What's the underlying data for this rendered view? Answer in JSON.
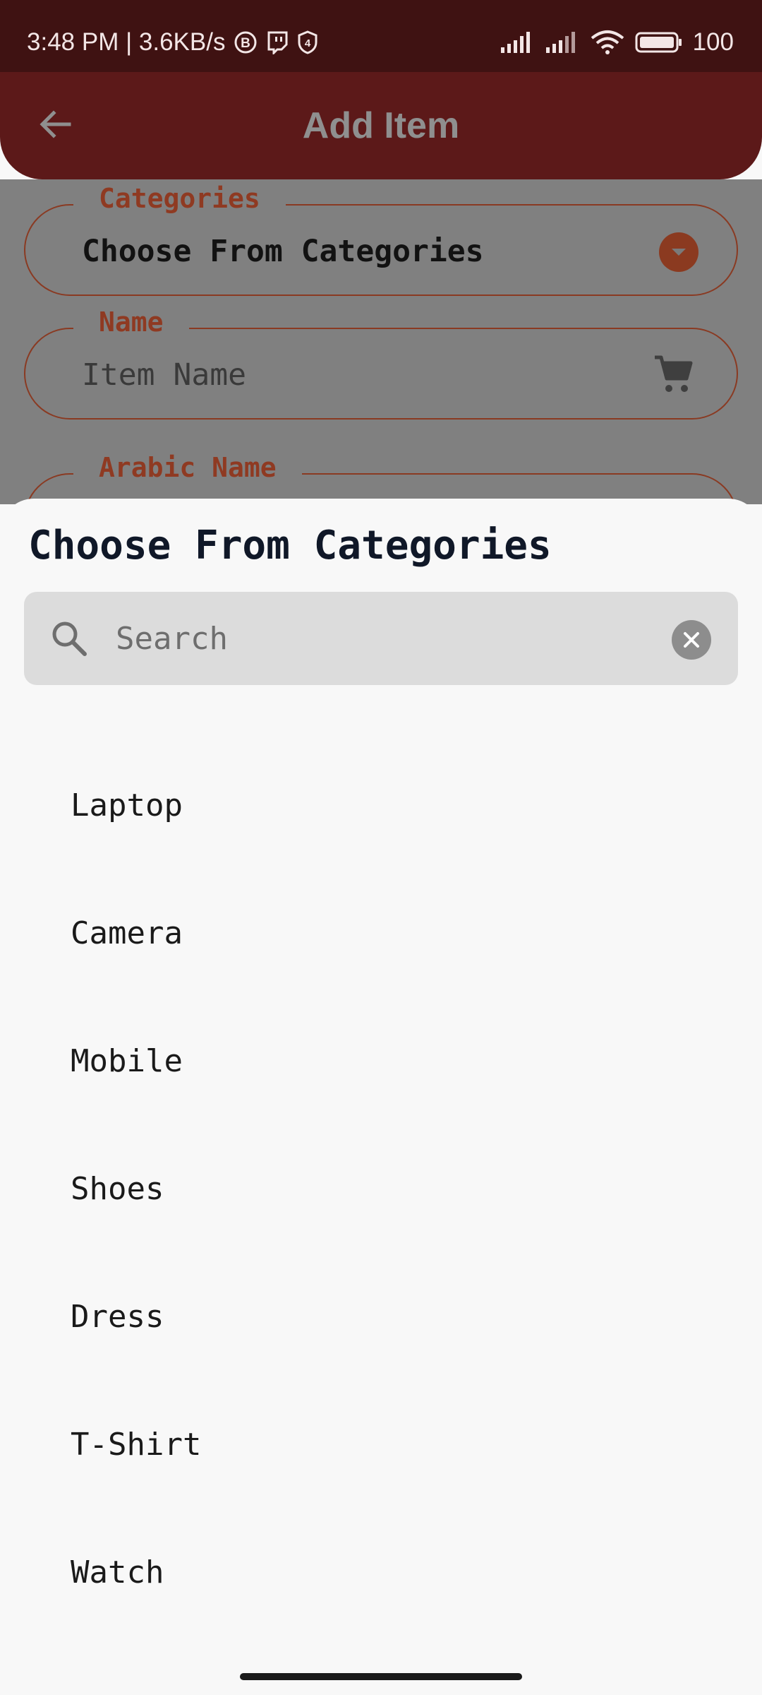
{
  "status_bar": {
    "time_speed": "3:48 PM | 3.6KB/s",
    "battery": "100",
    "icons": [
      "b-circle-icon",
      "twitch-icon",
      "shield-4-icon",
      "signal-icon",
      "signal-icon",
      "wifi-icon",
      "battery-icon"
    ]
  },
  "header": {
    "title": "Add Item",
    "back_icon": "arrow-left-icon"
  },
  "form": {
    "categories": {
      "label": "Categories",
      "value": "Choose From Categories",
      "icon": "dropdown-icon"
    },
    "name": {
      "label": "Name",
      "placeholder": "Item Name",
      "icon": "cart-icon"
    },
    "arabic_name": {
      "label": "Arabic Name"
    }
  },
  "sheet": {
    "title": "Choose From Categories",
    "search": {
      "placeholder": "Search",
      "icon": "search-icon",
      "clear_icon": "clear-icon"
    },
    "categories": [
      {
        "label": "Laptop"
      },
      {
        "label": "Camera"
      },
      {
        "label": "Mobile"
      },
      {
        "label": "Shoes"
      },
      {
        "label": "Dress"
      },
      {
        "label": "T-Shirt"
      },
      {
        "label": "Watch"
      }
    ]
  },
  "colors": {
    "status_bar": "#3f1212",
    "app_bar": "#5c1919",
    "accent": "#8b3a20",
    "overlay": "#808080",
    "sheet_bg": "#f8f8f8"
  }
}
